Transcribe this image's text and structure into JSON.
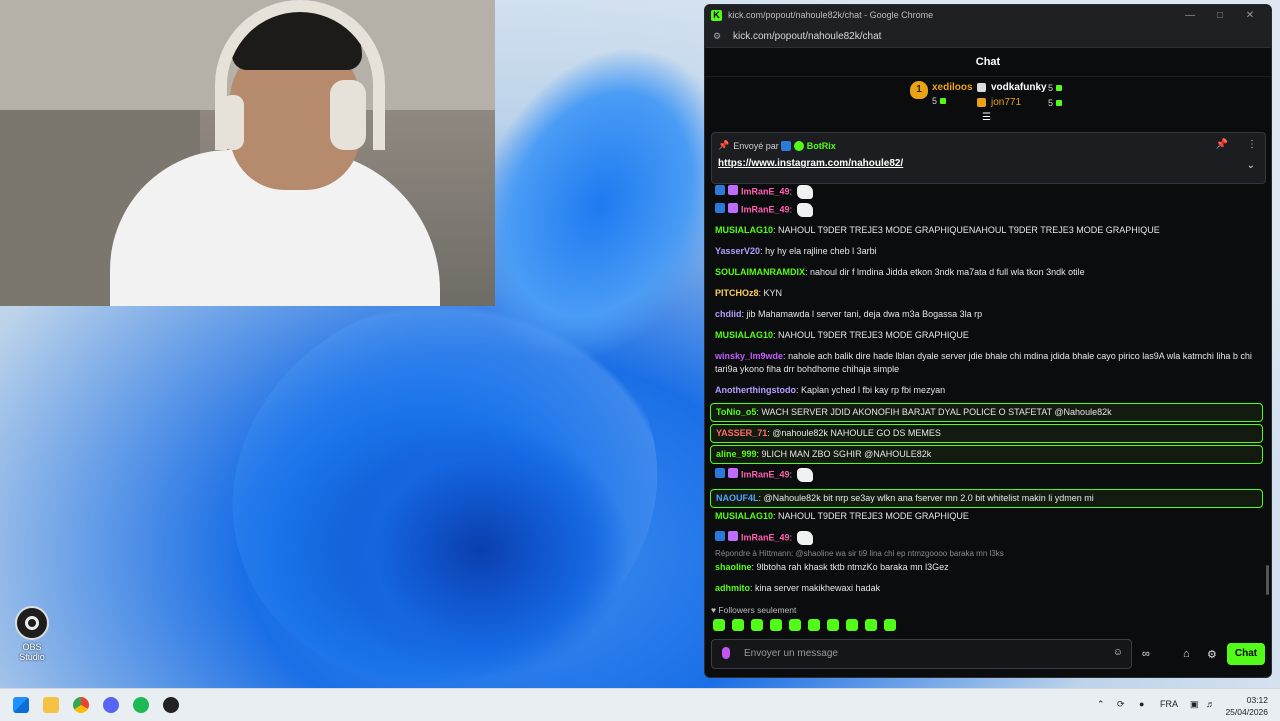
{
  "browser": {
    "window_title": "kick.com/popout/nahoule82k/chat - Google Chrome",
    "url": "kick.com/popout/nahoule82k/chat"
  },
  "chat": {
    "header": "Chat",
    "leaderboard": [
      {
        "rank": "1",
        "name": "xediloos",
        "count": "5",
        "color": "#e8a317"
      },
      {
        "name": "vodkafunky",
        "count": "5",
        "color": "#ffffff"
      },
      {
        "name": "jon771",
        "count": "5",
        "color": "#e8a317"
      }
    ],
    "pinned": {
      "sent_by": "Envoyé par",
      "author": "BotRix",
      "link": "https://www.instagram.com/nahoule82/"
    },
    "messages": [
      {
        "user": "ImRanE_49",
        "color": "#ff5fb0",
        "text": "",
        "emote": true,
        "badges": true
      },
      {
        "user": "ImRanE_49",
        "color": "#ff5fb0",
        "text": "",
        "emote": true,
        "badges": true
      },
      {
        "user": "MUSIALAG10",
        "color": "#53fc18",
        "text": "NAHOUL T9DER TREJE3 MODE GRAPHIQUENAHOUL T9DER TREJE3 MODE GRAPHIQUE"
      },
      {
        "user": "YasserV20",
        "color": "#b89cff",
        "text": "hy hy ela rajline cheb l 3arbi"
      },
      {
        "user": "SOULAIMANRAMDIX",
        "color": "#53fc18",
        "text": "nahoul dir f lmdina Jidda etkon 3ndk ma7ata d full wla tkon 3ndk otile"
      },
      {
        "user": "PITCHOz8",
        "color": "#ffcf5a",
        "text": "KYN"
      },
      {
        "user": "chdiid",
        "color": "#b89cff",
        "text": "jib Mahamawda l server tani, deja dwa m3a Bogassa 3la rp"
      },
      {
        "user": "MUSIALAG10",
        "color": "#53fc18",
        "text": "NAHOUL T9DER TREJE3 MODE GRAPHIQUE"
      },
      {
        "user": "winsky_lm9wde",
        "color": "#c45cff",
        "text": "nahole ach balik dire hade lblan dyale server jdie bhale chi mdina jdida bhale cayo pirico las9A wla katmchi liha b chi tari9a ykono fiha drr bohdhome chihaja simple"
      },
      {
        "user": "Anotherthingstodo",
        "color": "#b89cff",
        "text": "Kaplan yched l fbi kay rp fbi mezyan"
      },
      {
        "user": "ToNio_o5",
        "color": "#53fc18",
        "text": "WACH SERVER JDID AKONOFIH BARJAT DYAL POLICE O STAFETAT @Nahoule82k",
        "highlight": true
      },
      {
        "user": "YASSER_71",
        "color": "#ff6b6b",
        "text": "@nahoule82k NAHOULE GO DS MEMES",
        "highlight": true
      },
      {
        "user": "aline_999",
        "color": "#53fc18",
        "text": "9LICH MAN ZBO SGHIR @NAHOULE82k",
        "highlight": true
      },
      {
        "user": "ImRanE_49",
        "color": "#ff5fb0",
        "text": "",
        "emote": true,
        "badges": true
      },
      {
        "user": "NAOUF4L",
        "color": "#4fa3ff",
        "text": "@Nahoule82k bit nrp se3ay wlkn ana fserver mn 2.0 bit whitelist makin li ydmen mi",
        "highlight": true
      },
      {
        "user": "MUSIALAG10",
        "color": "#53fc18",
        "text": "NAHOUL T9DER TREJE3 MODE GRAPHIQUE"
      },
      {
        "user": "ImRanE_49",
        "color": "#ff5fb0",
        "text": "",
        "emote": true,
        "badges": true
      },
      {
        "user": "shaoline",
        "color": "#53fc18",
        "text": "9lbtoha rah khask tktb ntmzKo baraka mn l3Gez"
      },
      {
        "user": "adhmito",
        "color": "#53fc18",
        "text": "kina server makikhewaxi hadak"
      }
    ],
    "reply_to": "Répondre à Hittmann: @shaoline wa sir ti9 lina chi ep ntmzgoooo baraka mn l3ks",
    "followers_only": "Followers seulement",
    "input_placeholder": "Envoyer un message",
    "send_label": "Chat"
  },
  "desktop": {
    "icon_label": "OBS Studio"
  },
  "taskbar": {
    "language": "FRA",
    "time": "03:12",
    "date": "25/04/2026"
  }
}
